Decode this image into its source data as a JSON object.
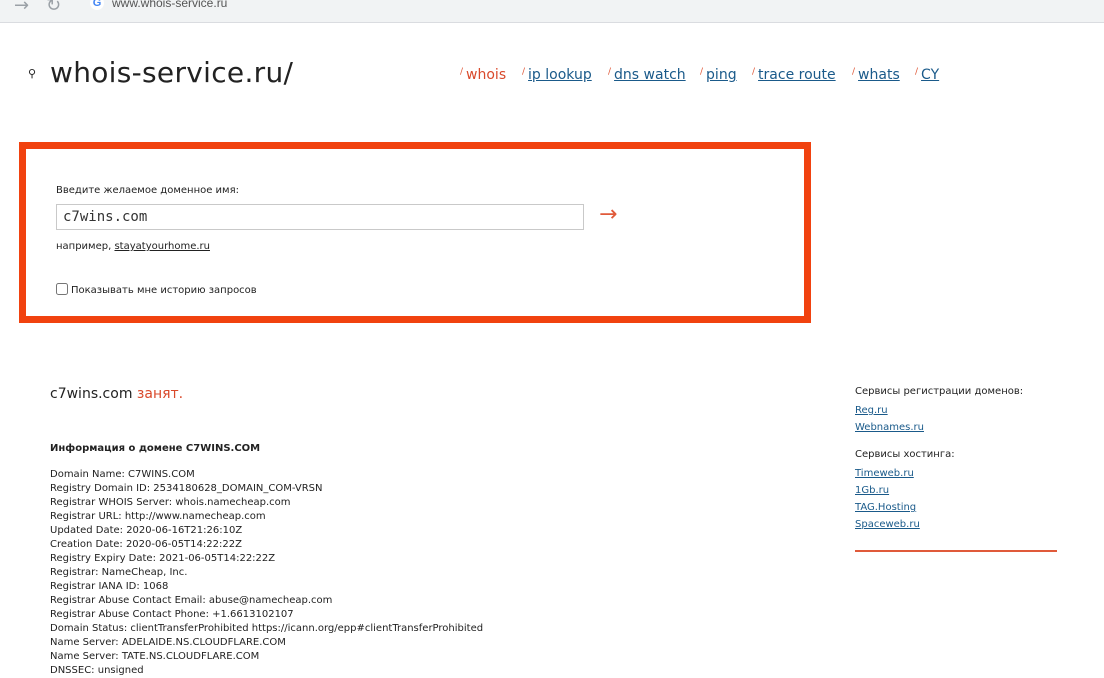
{
  "browser": {
    "forward_icon": "→",
    "reload_icon": "↻",
    "url": "www.whois-service.ru"
  },
  "logo": {
    "text": "whois-service.ru/"
  },
  "nav": {
    "slash": "/",
    "items": [
      {
        "label": "whois",
        "active": true
      },
      {
        "label": "ip lookup"
      },
      {
        "label": "dns watch"
      },
      {
        "label": "ping"
      },
      {
        "label": "trace route"
      },
      {
        "label": "whats"
      },
      {
        "label": "CY"
      }
    ]
  },
  "form": {
    "label": "Введите желаемое доменное имя:",
    "value": "c7wins.com",
    "example_prefix": "например,",
    "example_link": "stayatyourhome.ru",
    "submit_icon": "→",
    "history_label": "Показывать мне историю запросов"
  },
  "result": {
    "domain": "c7wins.com",
    "status": "занят."
  },
  "info": {
    "heading": "Информация о домене C7WINS.COM",
    "lines": [
      "Domain Name: C7WINS.COM",
      "Registry Domain ID: 2534180628_DOMAIN_COM-VRSN",
      "Registrar WHOIS Server: whois.namecheap.com",
      "Registrar URL: http://www.namecheap.com",
      "Updated Date: 2020-06-16T21:26:10Z",
      "Creation Date: 2020-06-05T14:22:22Z",
      "Registry Expiry Date: 2021-06-05T14:22:22Z",
      "Registrar: NameCheap, Inc.",
      "Registrar IANA ID: 1068",
      "Registrar Abuse Contact Email: abuse@namecheap.com",
      "Registrar Abuse Contact Phone: +1.6613102107",
      "Domain Status: clientTransferProhibited https://icann.org/epp#clientTransferProhibited",
      "Name Server: ADELAIDE.NS.CLOUDFLARE.COM",
      "Name Server: TATE.NS.CLOUDFLARE.COM",
      "DNSSEC: unsigned"
    ]
  },
  "sidebar": {
    "registration_heading": "Сервисы регистрации доменов:",
    "registration_links": [
      "Reg.ru",
      "Webnames.ru"
    ],
    "hosting_heading": "Сервисы хостинга:",
    "hosting_links": [
      "Timeweb.ru",
      "1Gb.ru",
      "TAG.Hosting",
      "Spaceweb.ru"
    ]
  },
  "colors": {
    "accent": "#f1420f",
    "link": "#1a5a8a",
    "busy": "#d9492b"
  }
}
